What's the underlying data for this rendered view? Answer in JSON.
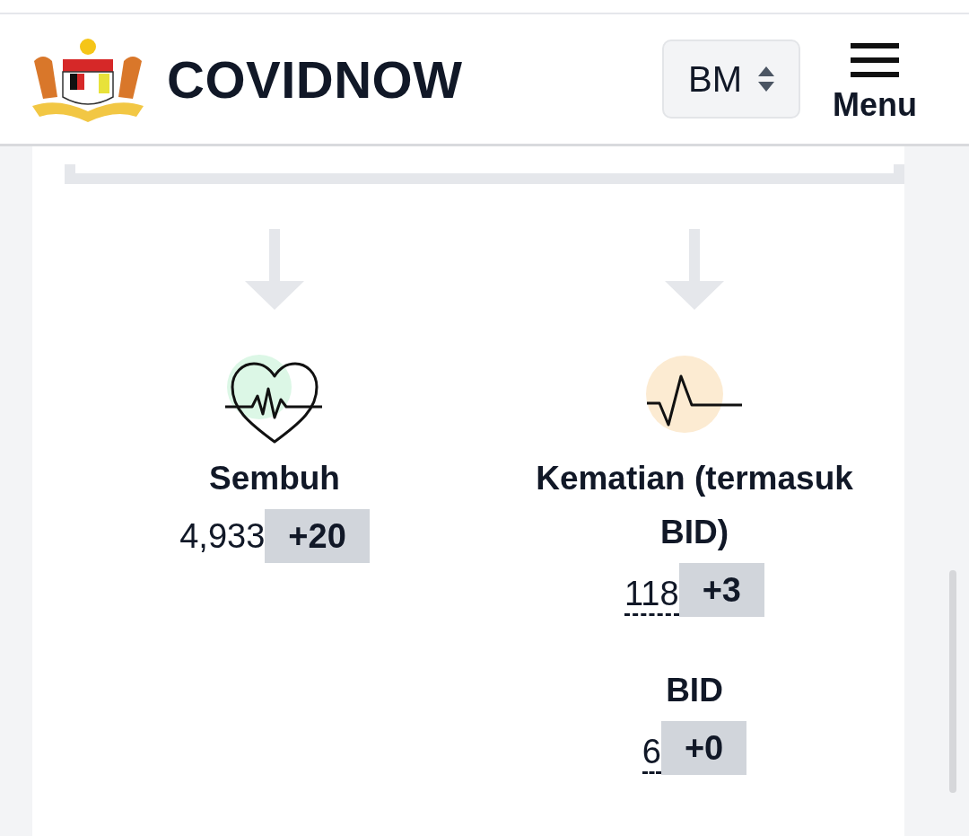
{
  "header": {
    "title": "COVIDNOW",
    "language": "BM",
    "menu": "Menu"
  },
  "columns": [
    {
      "kind": "recovered",
      "color": "#dcf7e6",
      "blocks": [
        {
          "title": "Sembuh",
          "value": "4,933",
          "delta": "+20",
          "has_tooltip": false
        }
      ]
    },
    {
      "kind": "deaths",
      "color": "#fcebd2",
      "blocks": [
        {
          "title": "Kematian (termasuk BID)",
          "value": "118",
          "delta": "+3",
          "has_tooltip": true
        },
        {
          "title": "BID",
          "value": "6",
          "delta": "+0",
          "has_tooltip": true
        }
      ]
    }
  ]
}
